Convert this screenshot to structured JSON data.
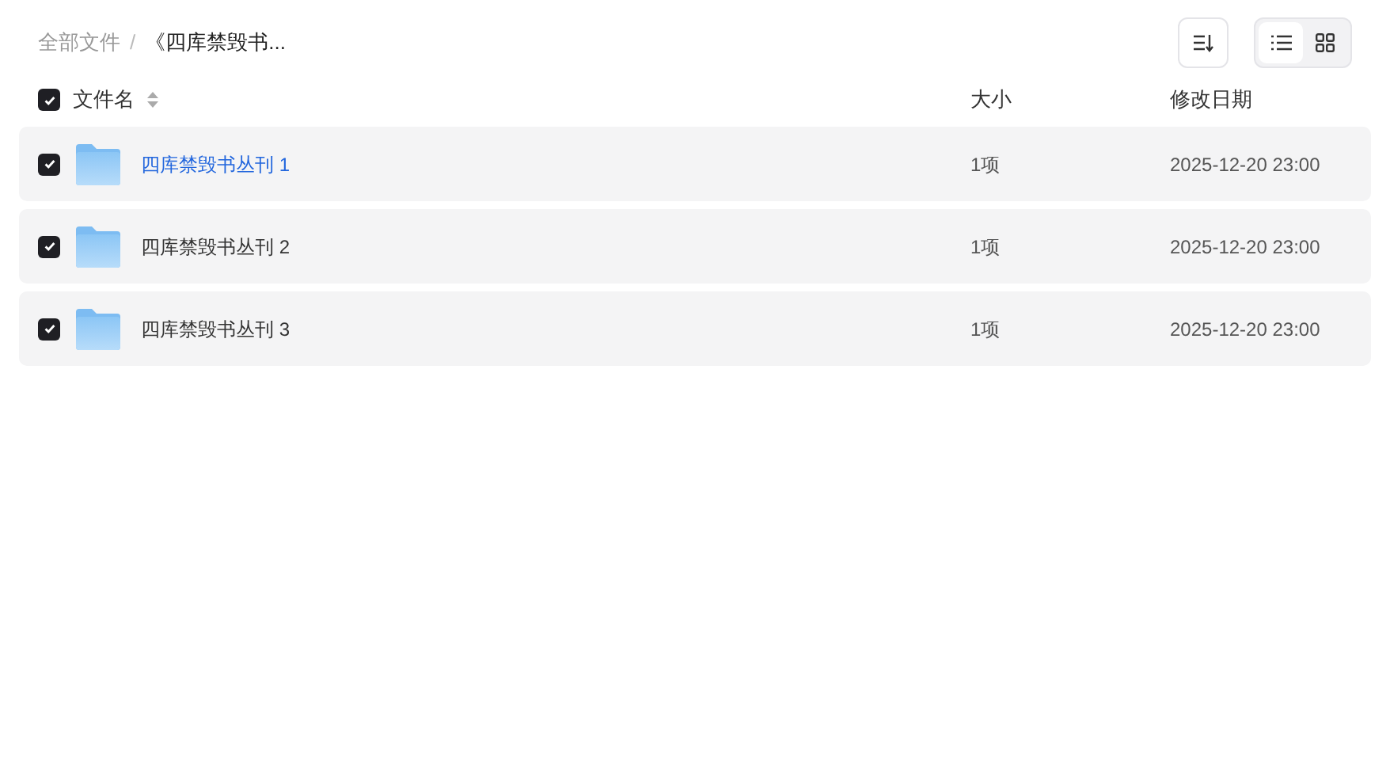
{
  "breadcrumb": {
    "separator": "/",
    "items": [
      {
        "label": "全部文件",
        "current": false
      },
      {
        "label": "《四库禁毁书...",
        "current": true
      }
    ]
  },
  "toolbar": {
    "views": [
      {
        "kind": "list",
        "selected": true
      },
      {
        "kind": "grid",
        "selected": false
      }
    ]
  },
  "table": {
    "select_all": {
      "checked": true
    },
    "columns": [
      {
        "label": "文件名",
        "sortable": true
      },
      {
        "label": "大小"
      },
      {
        "label": "修改日期"
      }
    ],
    "rows": [
      {
        "name": "四库禁毁书丛刊 1",
        "size": "1项",
        "modified": "2025-12-20 23:00",
        "checked": true,
        "hovered": true
      },
      {
        "name": "四库禁毁书丛刊 2",
        "size": "1项",
        "modified": "2025-12-20 23:00",
        "checked": true,
        "hovered": false
      },
      {
        "name": "四库禁毁书丛刊 3",
        "size": "1项",
        "modified": "2025-12-20 23:00",
        "checked": true,
        "hovered": false
      }
    ]
  }
}
